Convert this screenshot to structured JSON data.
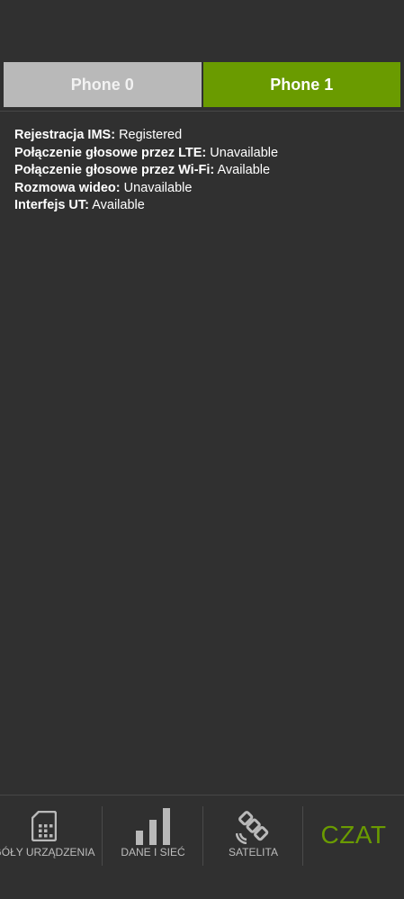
{
  "tabs": [
    {
      "label": "Phone 0",
      "active": false
    },
    {
      "label": "Phone 1",
      "active": true
    }
  ],
  "ims_info": [
    {
      "label": "Rejestracja IMS:",
      "value": "Registered"
    },
    {
      "label": "Połączenie głosowe przez LTE:",
      "value": "Unavailable"
    },
    {
      "label": "Połączenie głosowe przez Wi-Fi:",
      "value": "Available"
    },
    {
      "label": "Rozmowa wideo:",
      "value": "Unavailable"
    },
    {
      "label": "Interfejs UT:",
      "value": "Available"
    }
  ],
  "bottom_nav": {
    "items": [
      {
        "label": "GÓŁY URZĄDZENIA",
        "icon": "sim-card-icon"
      },
      {
        "label": "DANE I SIEĆ",
        "icon": "signal-bars-icon"
      },
      {
        "label": "SATELITA",
        "icon": "satellite-icon"
      },
      {
        "label": "CZAT",
        "icon": ""
      }
    ]
  },
  "colors": {
    "background": "#303030",
    "accent": "#6a9b00",
    "inactive_tab": "#b9b9b9",
    "text": "#ffffff",
    "muted_text": "#bdbdbd"
  }
}
